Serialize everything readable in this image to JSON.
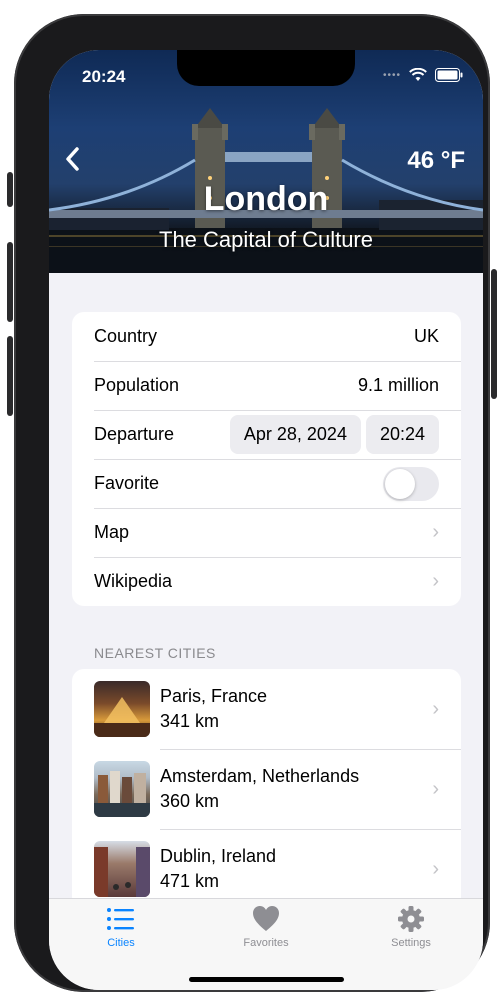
{
  "status": {
    "time": "20:24"
  },
  "header": {
    "temperature": "46 °F",
    "city": "London",
    "subtitle": "The Capital of Culture"
  },
  "details": {
    "country_label": "Country",
    "country_value": "UK",
    "population_label": "Population",
    "population_value": "9.1 million",
    "departure_label": "Departure",
    "departure_date": "Apr 28, 2024",
    "departure_time": "20:24",
    "favorite_label": "Favorite",
    "favorite_on": false,
    "map_label": "Map",
    "wikipedia_label": "Wikipedia"
  },
  "nearest": {
    "header": "NEAREST CITIES",
    "cities": [
      {
        "name": "Paris, France",
        "distance": "341 km"
      },
      {
        "name": "Amsterdam, Netherlands",
        "distance": "360 km"
      },
      {
        "name": "Dublin, Ireland",
        "distance": "471 km"
      }
    ]
  },
  "tabs": [
    {
      "label": "Cities",
      "icon": "list-icon",
      "active": true
    },
    {
      "label": "Favorites",
      "icon": "heart-icon",
      "active": false
    },
    {
      "label": "Settings",
      "icon": "gear-icon",
      "active": false
    }
  ],
  "colors": {
    "accent": "#0a84ff",
    "inactive": "#8e8e93"
  }
}
